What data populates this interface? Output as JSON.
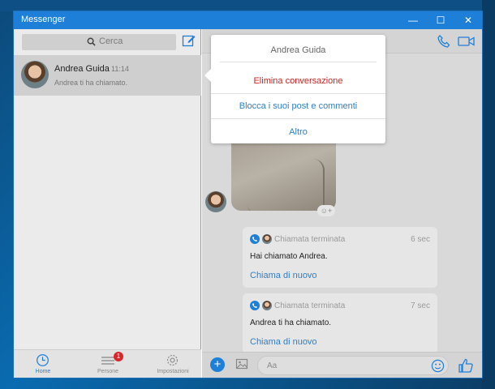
{
  "window": {
    "title": "Messenger",
    "minimize": "—",
    "maximize": "☐",
    "close": "✕"
  },
  "sidebar": {
    "search_placeholder": "Cerca",
    "conversation": {
      "name": "Andrea Guida",
      "time": "11:14",
      "preview": "Andrea ti ha chiamato."
    },
    "nav": [
      {
        "label": "Home",
        "icon": "clock-icon",
        "active": true
      },
      {
        "label": "Persone",
        "icon": "people-list-icon",
        "badge": "1"
      },
      {
        "label": "Impostazioni",
        "icon": "gear-icon"
      }
    ]
  },
  "popup": {
    "title": "Andrea Guida",
    "items": [
      "Elimina conversazione",
      "Blocca i suoi post e commenti",
      "Altro"
    ]
  },
  "calls": [
    {
      "status": "Chiamata terminata",
      "time": "6 sec",
      "message": "Hai chiamato Andrea.",
      "action": "Chiama di nuovo"
    },
    {
      "status": "Chiamata terminata",
      "time": "7 sec",
      "message": "Andrea ti ha chiamato.",
      "action": "Chiama di nuovo"
    }
  ],
  "composer": {
    "placeholder": "Aa"
  },
  "colors": {
    "accent": "#1e7fd9",
    "danger": "#d02020",
    "link": "#2f7fc8"
  }
}
